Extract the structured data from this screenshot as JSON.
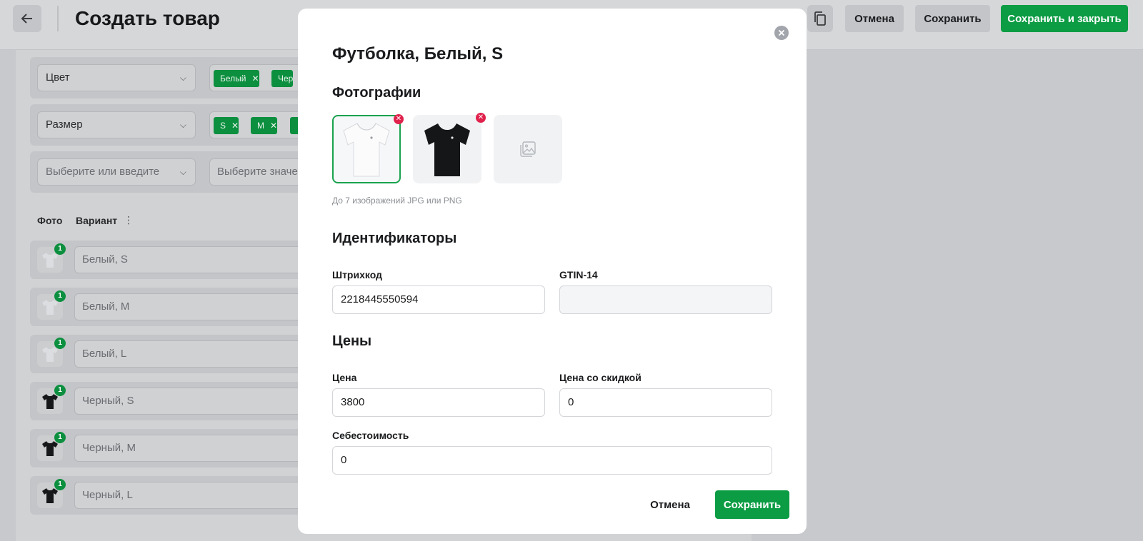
{
  "header": {
    "title": "Создать товар",
    "cancel_label": "Отмена",
    "save_label": "Сохранить",
    "save_close_label": "Сохранить и закрыть"
  },
  "options": [
    {
      "name": "Цвет",
      "values": [
        "Белый",
        "Чер"
      ]
    },
    {
      "name": "Размер",
      "values": [
        "S",
        "M"
      ]
    },
    {
      "name_placeholder": "Выберите или введите",
      "values_placeholder": "Выберите значе"
    }
  ],
  "variants_table": {
    "col_photo": "Фото",
    "col_variant": "Вариант",
    "rows": [
      {
        "name": "Белый, S",
        "badge": "1",
        "color": "white"
      },
      {
        "name": "Белый, M",
        "badge": "1",
        "color": "white"
      },
      {
        "name": "Белый, L",
        "badge": "1",
        "color": "white"
      },
      {
        "name": "Черный, S",
        "badge": "1",
        "color": "black"
      },
      {
        "name": "Черный, M",
        "badge": "1",
        "color": "black"
      },
      {
        "name": "Черный, L",
        "badge": "1",
        "color": "black"
      }
    ]
  },
  "modal": {
    "title": "Футболка, Белый, S",
    "photos_title": "Фотографии",
    "photos_hint": "До 7 изображений JPG или PNG",
    "ids_title": "Идентификаторы",
    "barcode_label": "Штрихкод",
    "barcode_value": "2218445550594",
    "gtin_label": "GTIN-14",
    "gtin_value": "",
    "prices_title": "Цены",
    "price_label": "Цена",
    "price_value": "3800",
    "discount_label": "Цена со скидкой",
    "discount_value": "0",
    "cost_label": "Себестоимость",
    "cost_value": "0",
    "cancel_label": "Отмена",
    "save_label": "Сохранить"
  },
  "colors": {
    "accent_green": "#0c9c44",
    "delete_red": "#e0224c"
  }
}
